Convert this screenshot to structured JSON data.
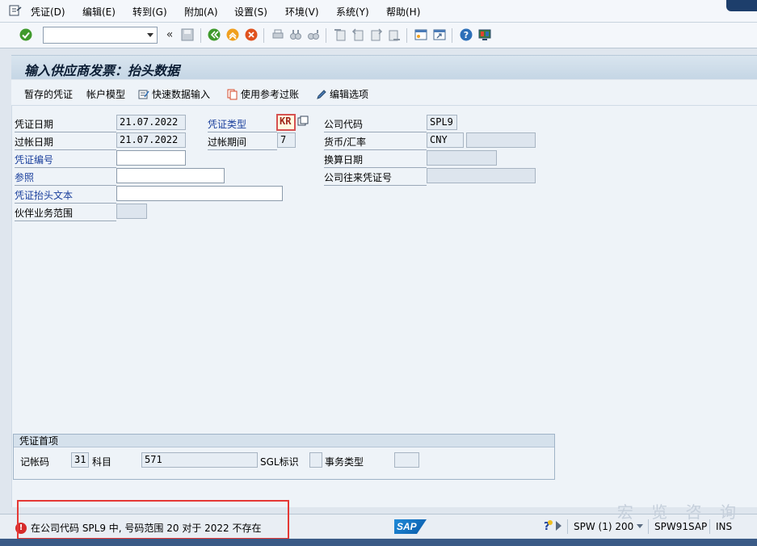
{
  "menubar": {
    "items": [
      "凭证(D)",
      "编辑(E)",
      "转到(G)",
      "附加(A)",
      "设置(S)",
      "环境(V)",
      "系统(Y)",
      "帮助(H)"
    ]
  },
  "toolbar": {
    "command_value": "",
    "icons": [
      "check-icon",
      "save-icon",
      "back-icon",
      "exit-icon",
      "cancel-icon",
      "print-icon",
      "find-icon",
      "find-next-icon",
      "first-page-icon",
      "prev-page-icon",
      "next-page-icon",
      "last-page-icon",
      "create-session-icon",
      "shortcut-icon",
      "help-icon",
      "customize-layout-icon"
    ]
  },
  "title": "输入供应商发票：抬头数据",
  "app_toolbar": {
    "parked_docs": "暂存的凭证",
    "account_model": "帐户模型",
    "fast_entry": "快速数据输入",
    "post_with_reference": "使用参考过账",
    "editing_options": "编辑选项"
  },
  "form": {
    "doc_date_label": "凭证日期",
    "doc_date_value": "21.07.2022",
    "posting_date_label": "过帐日期",
    "posting_date_value": "21.07.2022",
    "doc_number_label": "凭证编号",
    "reference_label": "参照",
    "header_text_label": "凭证抬头文本",
    "trading_partner_label": "伙伴业务范围",
    "doc_type_label": "凭证类型",
    "doc_type_value": "KR",
    "period_label": "过帐期间",
    "period_value": "7",
    "company_code_label": "公司代码",
    "company_code_value": "SPL9",
    "currency_label": "货币/汇率",
    "currency_value": "CNY",
    "translation_date_label": "换算日期",
    "cross_cc_label": "公司往来凭证号"
  },
  "first_item": {
    "header": "凭证首项",
    "posting_key_label": "记帐码",
    "posting_key_value": "31",
    "account_label": "科目",
    "account_value": "571",
    "sgl_label": "SGL标识",
    "trans_type_label": "事务类型"
  },
  "status": {
    "message": "在公司代码 SPL9 中, 号码范围 20 对于 2022 不存在",
    "system": "SPW (1) 200",
    "server": "SPW91SAP",
    "mode": "INS",
    "logo": "SAP"
  },
  "watermark": "宏 览 咨 询",
  "colors": {
    "error": "#d62a2a",
    "highlight_box": "#e53935",
    "link": "#1a3f9c"
  }
}
